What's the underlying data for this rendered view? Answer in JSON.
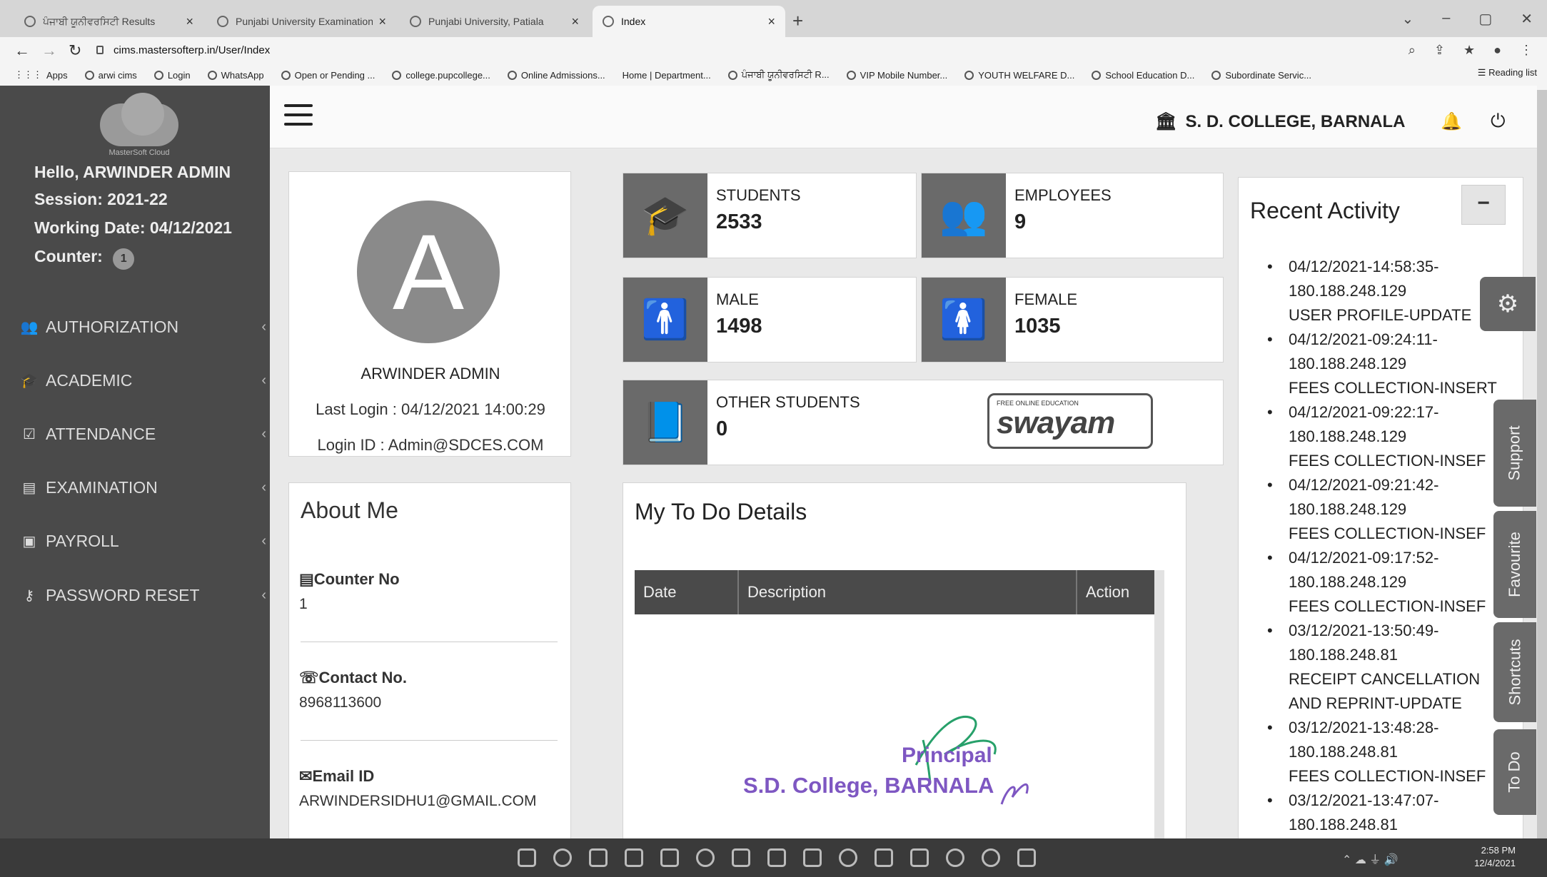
{
  "browser": {
    "tabs": [
      {
        "title": "ਪੰਜਾਬੀ ਯੂਨੀਵਰਸਿਟੀ Results"
      },
      {
        "title": "Punjabi University Examination"
      },
      {
        "title": "Punjabi University, Patiala"
      },
      {
        "title": "Index"
      }
    ],
    "url": "cims.mastersofterp.in/User/Index",
    "bookmarks": [
      "Apps",
      "arwi cims",
      "Login",
      "WhatsApp",
      "Open or Pending ...",
      "college.pupcollege...",
      "Online Admissions...",
      "Home | Department...",
      "ਪੰਜਾਬੀ ਯੂਨੀਵਰਸਿਟੀ R...",
      "VIP Mobile Number...",
      "YOUTH WELFARE D...",
      "School Education D...",
      "Subordinate Servic..."
    ],
    "reading_list": "Reading list"
  },
  "sidebar": {
    "logo_text": "MasterSoft Cloud",
    "greeting": "Hello, ARWINDER ADMIN",
    "session": "Session: 2021-22",
    "working_date": "Working Date: 04/12/2021",
    "counter_label": "Counter:",
    "counter_value": "1",
    "menu": [
      {
        "label": "AUTHORIZATION",
        "icon": "users-cog-icon"
      },
      {
        "label": "ACADEMIC",
        "icon": "graduation-cap-icon"
      },
      {
        "label": "ATTENDANCE",
        "icon": "checkbox-icon"
      },
      {
        "label": "EXAMINATION",
        "icon": "book-icon"
      },
      {
        "label": "PAYROLL",
        "icon": "money-icon"
      },
      {
        "label": "PASSWORD RESET",
        "icon": "key-icon"
      }
    ]
  },
  "header": {
    "college": "S. D. COLLEGE, BARNALA"
  },
  "profile": {
    "initial": "A",
    "name": "ARWINDER ADMIN",
    "last_login": "Last Login : 04/12/2021 14:00:29",
    "login_id": "Login ID : Admin@SDCES.COM"
  },
  "stats": {
    "students": {
      "label": "STUDENTS",
      "value": "2533"
    },
    "employees": {
      "label": "EMPLOYEES",
      "value": "9"
    },
    "male": {
      "label": "MALE",
      "value": "1498"
    },
    "female": {
      "label": "FEMALE",
      "value": "1035"
    },
    "other": {
      "label": "OTHER STUDENTS",
      "value": "0"
    },
    "swayam_top": "FREE ONLINE EDUCATION",
    "swayam": "swayam"
  },
  "about": {
    "title": "About Me",
    "counter_label": "Counter No",
    "counter_value": "1",
    "contact_label": "Contact No.",
    "contact_value": "8968113600",
    "email_label": "Email ID",
    "email_value": "ARWINDERSIDHU1@GMAIL.COM"
  },
  "todo": {
    "title": "My To Do Details",
    "columns": [
      "Date",
      "Description",
      "Action"
    ],
    "stamp_line1": "Principal",
    "stamp_line2": "S.D. College, BARNALA"
  },
  "activity": {
    "title": "Recent Activity",
    "collapse": "−",
    "items": [
      {
        "line1": "04/12/2021-14:58:35-",
        "line2": "180.188.248.129",
        "line3": "USER PROFILE-UPDATE"
      },
      {
        "line1": "04/12/2021-09:24:11-",
        "line2": "180.188.248.129",
        "line3": "FEES COLLECTION-INSERT"
      },
      {
        "line1": "04/12/2021-09:22:17-",
        "line2": "180.188.248.129",
        "line3": "FEES COLLECTION-INSEF"
      },
      {
        "line1": "04/12/2021-09:21:42-",
        "line2": "180.188.248.129",
        "line3": "FEES COLLECTION-INSEF"
      },
      {
        "line1": "04/12/2021-09:17:52-",
        "line2": "180.188.248.129",
        "line3": "FEES COLLECTION-INSEF"
      },
      {
        "line1": "03/12/2021-13:50:49-",
        "line2": "180.188.248.81",
        "line3": "RECEIPT CANCELLATION",
        "line4": "AND REPRINT-UPDATE"
      },
      {
        "line1": "03/12/2021-13:48:28-",
        "line2": "180.188.248.81",
        "line3": "FEES COLLECTION-INSEF"
      },
      {
        "line1": "03/12/2021-13:47:07-",
        "line2": "180.188.248.81"
      }
    ]
  },
  "side_tabs": [
    "Support",
    "Favourite",
    "Shortcuts",
    "To Do"
  ],
  "taskbar": {
    "time": "2:58 PM",
    "date": "12/4/2021"
  }
}
